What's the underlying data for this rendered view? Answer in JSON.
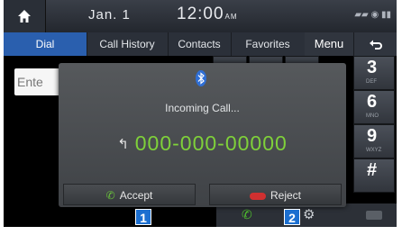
{
  "statusbar": {
    "date": "Jan.  1",
    "time": "12:00",
    "ampm": "AM",
    "icons": "▰▰ ◉ ▮▮"
  },
  "tabs": [
    {
      "label": "Dial",
      "active": true
    },
    {
      "label": "Call History",
      "active": false
    },
    {
      "label": "Contacts",
      "active": false
    },
    {
      "label": "Favorites",
      "active": false
    }
  ],
  "menu_label": "Menu",
  "number_field": {
    "placeholder": "Ente"
  },
  "keypad": [
    {
      "digit": "3",
      "sub": "DEF"
    },
    {
      "digit": "6",
      "sub": "MNO"
    },
    {
      "digit": "9",
      "sub": "WXYZ"
    },
    {
      "digit": "#",
      "sub": ""
    }
  ],
  "popup": {
    "title": "Incoming Call...",
    "number": "000-000-00000",
    "accept_label": "Accept",
    "reject_label": "Reject"
  },
  "markers": {
    "m1": "1",
    "m2": "2"
  },
  "colors": {
    "accent": "#2a5fae",
    "number_green": "#7fd13a",
    "accept": "#69c23a",
    "reject": "#d03030",
    "marker": "#1c6fd0"
  }
}
